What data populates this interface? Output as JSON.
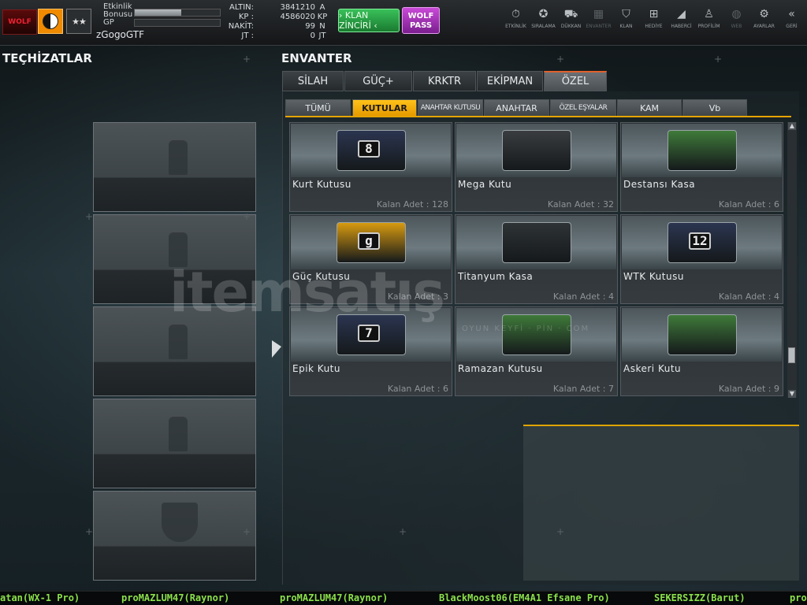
{
  "player": {
    "logo_text": "WOLF",
    "rank_text": "★★",
    "event_bonus_label": "Etkinlik\nBonusu",
    "gp_label": "GP",
    "event_bonus_fill": 0.55,
    "gp_fill": 0.0,
    "username": "zGogoGTF"
  },
  "currency": [
    {
      "key": "ALTIN:",
      "value": "3841210",
      "unit": "A"
    },
    {
      "key": "KP :",
      "value": "4586020",
      "unit": "KP"
    },
    {
      "key": "NAKİT:",
      "value": "99",
      "unit": "N"
    },
    {
      "key": "JT :",
      "value": "0",
      "unit": "JT"
    }
  ],
  "buttons": {
    "klan_zinciri": "› KLAN ZİNCİRİ ‹",
    "wolf_pass": "WOLF\nPASS"
  },
  "nav": [
    {
      "label": "ETKİNLİK",
      "icon": "stopwatch-icon",
      "glyph": "⏱",
      "enabled": true
    },
    {
      "label": "SIRALAMA",
      "icon": "medal-icon",
      "glyph": "✪",
      "enabled": true
    },
    {
      "label": "DÜKKAN",
      "icon": "cart-icon",
      "glyph": "⛟",
      "enabled": true
    },
    {
      "label": "ENVANTER",
      "icon": "inventory-icon",
      "glyph": "▦",
      "enabled": false
    },
    {
      "label": "KLAN",
      "icon": "clan-shield-icon",
      "glyph": "⛉",
      "enabled": true
    },
    {
      "label": "HEDİYE",
      "icon": "gift-icon",
      "glyph": "⊞",
      "enabled": true
    },
    {
      "label": "HABERCİ",
      "icon": "megaphone-icon",
      "glyph": "◢",
      "enabled": true
    },
    {
      "label": "PROFİLİM",
      "icon": "profile-icon",
      "glyph": "♙",
      "enabled": true
    },
    {
      "label": "WEB",
      "icon": "globe-icon",
      "glyph": "◍",
      "enabled": false
    },
    {
      "label": "AYARLAR",
      "icon": "gear-icon",
      "glyph": "⚙",
      "enabled": true
    },
    {
      "label": "GERİ",
      "icon": "back-chevron-icon",
      "glyph": "«",
      "enabled": true
    }
  ],
  "left": {
    "title": "TEÇHİZATLAR",
    "slots": [
      {
        "icon": "spray-can-icon"
      },
      {
        "icon": "spray-can-icon"
      },
      {
        "icon": "spray-can-icon"
      },
      {
        "icon": "spray-can-icon"
      },
      {
        "icon": "shield-icon"
      }
    ]
  },
  "inventory": {
    "title": "ENVANTER",
    "tabs": [
      "SİLAH",
      "GÜÇ+",
      "KRKTR",
      "EKİPMAN",
      "ÖZEL"
    ],
    "active_tab": "ÖZEL",
    "subtabs": [
      "TÜMÜ",
      "KUTULAR",
      "ANAHTAR KUTUSU",
      "ANAHTAR",
      "ÖZEL EŞYALAR",
      "KAM",
      "Vb"
    ],
    "active_subtab": "KUTULAR",
    "items": [
      {
        "name": "Kurt Kutusu",
        "count": "Kalan Adet : 128",
        "color": "#2b3550",
        "badge": "8"
      },
      {
        "name": "Mega Kutu",
        "count": "Kalan Adet : 32",
        "color": "#3a3d40",
        "badge": ""
      },
      {
        "name": "Destansı Kasa",
        "count": "Kalan Adet : 6",
        "color": "#3f7a3a",
        "badge": ""
      },
      {
        "name": "Güç Kutusu",
        "count": "Kalan Adet : 3",
        "color": "#d79a10",
        "badge": "g"
      },
      {
        "name": "Titanyum Kasa",
        "count": "Kalan Adet : 4",
        "color": "#2e3336",
        "badge": ""
      },
      {
        "name": "WTK Kutusu",
        "count": "Kalan Adet : 4",
        "color": "#2b3550",
        "badge": "12"
      },
      {
        "name": "Epik Kutu",
        "count": "Kalan Adet : 6",
        "color": "#2b3550",
        "badge": "7"
      },
      {
        "name": "Ramazan Kutusu",
        "count": "Kalan Adet : 7",
        "color": "#3f7a3a",
        "badge": ""
      },
      {
        "name": "Askeri Kutu",
        "count": "Kalan Adet : 9",
        "color": "#3f7a3a",
        "badge": ""
      }
    ]
  },
  "watermark": {
    "text": "itemsatış",
    "sub": "OYUN KEYFİ · PİN · COM"
  },
  "ticker": [
    "atan(WX-1 Pro)",
    "proMAZLUM47(Raynor)",
    "proMAZLUM47(Raynor)",
    "BlackMoost06(EM4A1 Efsane Pro)",
    "SEKERSIZZ(Barut)",
    "pro"
  ]
}
